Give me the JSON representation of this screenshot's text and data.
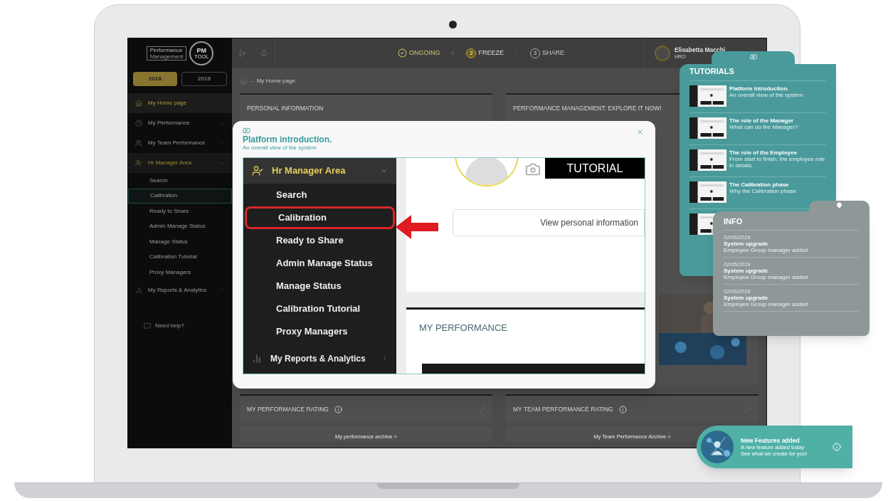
{
  "app": {
    "logo": {
      "line1": "Performance",
      "line2": "Management",
      "badge": "PM",
      "badge_sub": "TOOL"
    },
    "years": [
      {
        "label": "2018",
        "selected": true
      },
      {
        "label": "2019",
        "selected": false
      }
    ],
    "sidebar": {
      "items": [
        {
          "label": "My Home page",
          "selected": true
        },
        {
          "label": "My Performance",
          "selected": false,
          "expanded": false
        },
        {
          "label": "My Team Performance",
          "selected": false,
          "expanded": false
        },
        {
          "label": "Hr Manager Area",
          "selected": false,
          "expanded": true,
          "children": [
            {
              "label": "Search",
              "selected": false
            },
            {
              "label": "Calibration",
              "selected": true
            },
            {
              "label": "Ready to Share",
              "selected": false
            },
            {
              "label": "Admin Manage Status",
              "selected": false
            },
            {
              "label": "Manage Status",
              "selected": false
            },
            {
              "label": "Calibration Tutorial",
              "selected": false
            },
            {
              "label": "Proxy Managers",
              "selected": false
            }
          ]
        },
        {
          "label": "My Reports & Analytics",
          "selected": false,
          "expanded": false
        }
      ]
    },
    "help": "Need help?",
    "steps": [
      {
        "label": "ONGOING",
        "kind": "done"
      },
      {
        "label": "FREEZE",
        "kind": "current",
        "number": "2"
      },
      {
        "label": "SHARE",
        "kind": "todo",
        "number": "3"
      }
    ],
    "user": {
      "name": "Elisabetta Macchi",
      "role": "HRO"
    },
    "breadcrumb_separator": "-",
    "breadcrumb": "My Home page",
    "cards": [
      {
        "title": "PERSONAL INFORMATION"
      },
      {
        "title": "PERFORMANCE MANAGEMENT: EXPLORE IT NOW!"
      }
    ],
    "rating_cards": [
      {
        "title": "MY PERFORMANCE RATING",
        "link": "My performance archive >"
      },
      {
        "title": "MY TEAM PERFORMANCE RATING",
        "link": "My Team Performance Archive >"
      }
    ]
  },
  "modal": {
    "title": "Platform introduction.",
    "subtitle": "An overall view of the system",
    "menu": {
      "label": "Hr Manager Area",
      "expanded": true,
      "items": [
        {
          "label": "Search",
          "highlighted": false
        },
        {
          "label": "Calibration",
          "highlighted": true
        },
        {
          "label": "Ready to Share",
          "highlighted": false
        },
        {
          "label": "Admin Manage Status",
          "highlighted": false
        },
        {
          "label": "Manage Status",
          "highlighted": false
        },
        {
          "label": "Calibration Tutorial",
          "highlighted": false
        },
        {
          "label": "Proxy Managers",
          "highlighted": false
        }
      ],
      "footer": "My Reports & Analytics"
    },
    "tag": "TUTORIAL",
    "button": "View personal information",
    "section": "MY PERFORMANCE"
  },
  "tutorials": {
    "title": "TUTORIALS",
    "items": [
      {
        "title": "Platform introduction.",
        "subtitle": "An overall view of the system"
      },
      {
        "title": "The role of the Manager",
        "subtitle": "What can do the Manager?"
      },
      {
        "title": "The role of the Employee",
        "subtitle": "From start to finish, the employee role in details"
      },
      {
        "title": "The Calibration phase",
        "subtitle": "Why the Calibration phase"
      }
    ]
  },
  "info": {
    "title": "INFO",
    "entries": [
      {
        "date": "02/05/2019",
        "title": "System upgrade",
        "text": "Employee Group manager added"
      },
      {
        "date": "02/05/2019",
        "title": "System upgrade",
        "text": "Employee Group manager added"
      },
      {
        "date": "02/05/2019",
        "title": "System upgrade",
        "text": "Employee Group manager added"
      }
    ]
  },
  "toast": {
    "title": "New Features added",
    "line1": "A new feature added today",
    "line2": "See what we create for you!"
  }
}
